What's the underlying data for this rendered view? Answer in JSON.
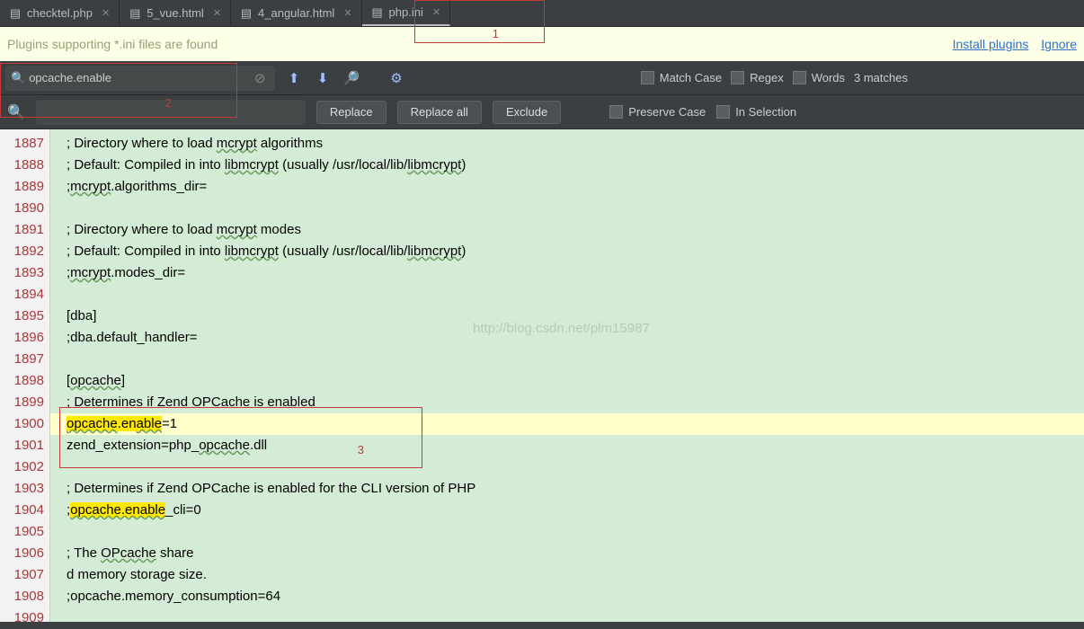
{
  "tabs": [
    {
      "label": "checktel.php"
    },
    {
      "label": "5_vue.html"
    },
    {
      "label": "4_angular.html"
    },
    {
      "label": "php.ini"
    }
  ],
  "notif": {
    "message": "Plugins supporting *.ini files are found",
    "install": "Install plugins",
    "ignore": "Ignore"
  },
  "search": {
    "query": "opcache.enable",
    "match_case": "Match Case",
    "regex": "Regex",
    "words": "Words",
    "result": "3 matches"
  },
  "replace": {
    "replace": "Replace",
    "replace_all": "Replace all",
    "exclude": "Exclude",
    "preserve": "Preserve Case",
    "in_selection": "In Selection"
  },
  "gutter_start": 1887,
  "gutter_count": 23,
  "code_lines": {
    "l0": "; Directory where to load ",
    "l0b": " algorithms",
    "l1": "; Default: Compiled in into ",
    "l1b": " (usually /usr/local/lib/",
    "l1c": ")",
    "l2": ";",
    "l2b": ".algorithms_dir=",
    "l3": "",
    "l4": "; Directory where to load ",
    "l4b": " modes",
    "l5": "; Default: Compiled in into ",
    "l5b": " (usually /usr/local/lib/",
    "l5c": ")",
    "l6": ";",
    "l6b": ".modes_dir=",
    "l7": "",
    "l8": "[dba]",
    "l9": ";dba.default_handler=",
    "l10": "",
    "l11": "[",
    "l11b": "]",
    "l12": "; Determines if Zend OPCache is enabled",
    "l13a": "opcache",
    "l13b": ".en",
    "l13c": "able",
    "l13d": "=1",
    "l14": "zend_extension=php_",
    "l14b": ".dll",
    "l15": "",
    "l16": "; Determines if Zend OPCache is enabled for the CLI version of PHP",
    "l17": ";",
    "l17b": "opcache.enable",
    "l17c": "_cli=0",
    "l18": "",
    "l19": "; The ",
    "l19b": " share",
    "l20": "d memory storage size.",
    "l21": ";opcache.memory_consumption=64",
    "l22": "",
    "mcrypt": "mcrypt",
    "libmcrypt": "libmcrypt",
    "opcache_word": "opcache",
    "opcache_u": "OPcache"
  },
  "watermark": "http://blog.csdn.net/plm15987",
  "annos": {
    "a1": "1",
    "a2": "2",
    "a3": "3"
  }
}
